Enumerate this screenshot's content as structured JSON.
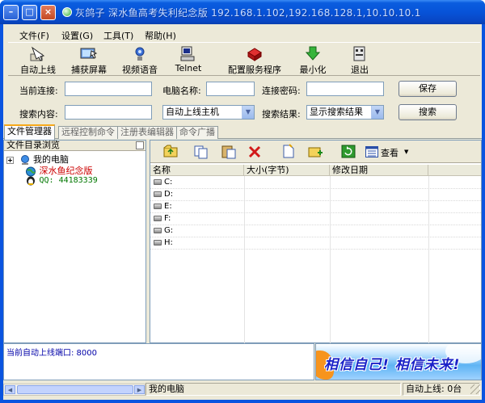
{
  "window": {
    "title": "灰鸽子  深水鱼高考失利纪念版 192.168.1.102,192.168.128.1,10.10.10.1",
    "min_label": "–",
    "max_label": "□",
    "close_label": "×"
  },
  "menu": [
    "文件(F)",
    "设置(G)",
    "工具(T)",
    "帮助(H)"
  ],
  "toolbar": [
    {
      "label": "自动上线",
      "icon": "auto-online-icon"
    },
    {
      "label": "捕获屏幕",
      "icon": "capture-screen-icon"
    },
    {
      "label": "视频语音",
      "icon": "video-voice-icon"
    },
    {
      "label": "Telnet",
      "icon": "telnet-icon"
    },
    {
      "label": "配置服务程序",
      "icon": "configure-server-icon"
    },
    {
      "label": "最小化",
      "icon": "minimize-arrow-icon"
    },
    {
      "label": "退出",
      "icon": "exit-icon"
    }
  ],
  "conn": {
    "current_label": "当前连接:",
    "computer_label": "电脑名称:",
    "password_label": "连接密码:",
    "save_label": "保存",
    "current_value": "",
    "computer_value": "",
    "password_value": ""
  },
  "search": {
    "content_label": "搜索内容:",
    "content_value": "",
    "scope_value": "自动上线主机",
    "result_label": "搜索结果:",
    "result_value": "显示搜索结果",
    "search_label": "搜索"
  },
  "tabs": [
    "文件管理器",
    "远程控制命令",
    "注册表编辑器",
    "命令广播"
  ],
  "tree": {
    "header": "文件目录浏览",
    "root": "我的电脑",
    "host": "深水鱼纪念版",
    "qq": "QQ: 44183339"
  },
  "right_toolbar": {
    "view_label": "查看"
  },
  "grid": {
    "columns": [
      "名称",
      "大小(字节)",
      "修改日期"
    ],
    "rows": [
      "C:",
      "D:",
      "E:",
      "F:",
      "G:",
      "H:"
    ]
  },
  "log": {
    "line1": "当前自动上线端口: 8000"
  },
  "banner": {
    "text": "相信自己! 相信未来!"
  },
  "status": {
    "path": "我的电脑",
    "online": "自动上线: 0台"
  },
  "colors": {
    "title_bar": "#0753d8",
    "host_red": "#cc0000",
    "qq_green": "#007700",
    "log_blue": "#0000a8"
  }
}
